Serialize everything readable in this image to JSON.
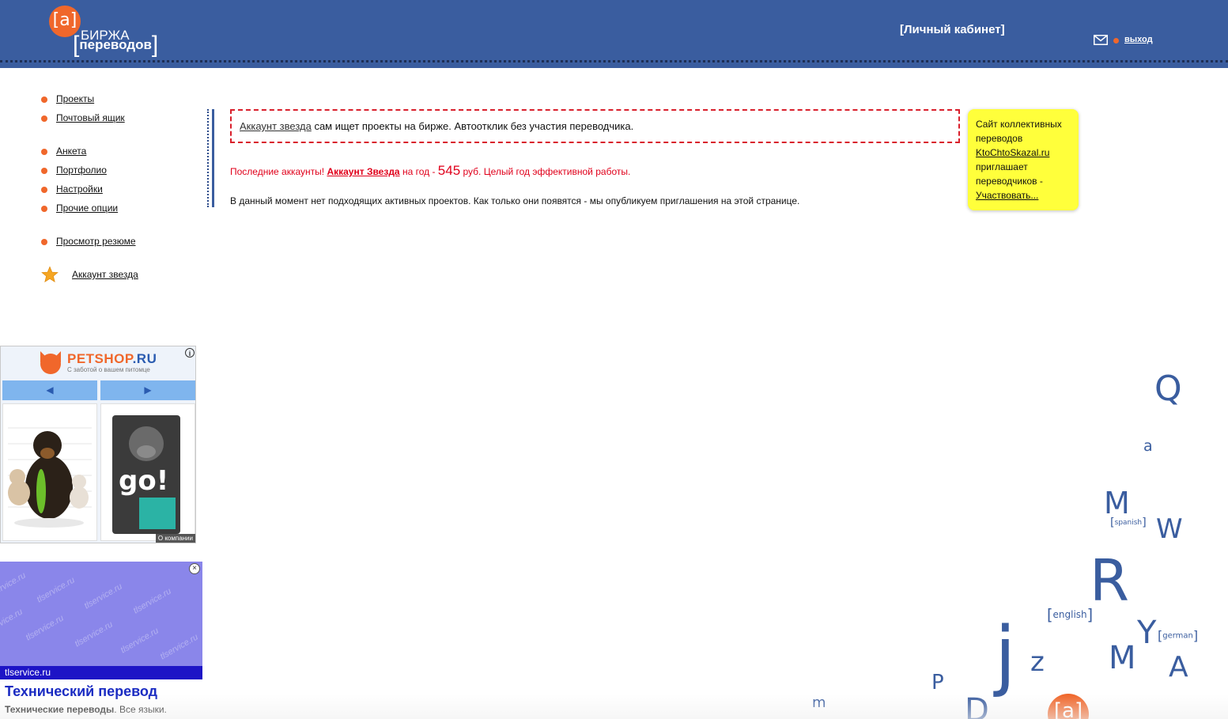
{
  "header": {
    "logo_badge": "[a]",
    "logo_top": "БИРЖА",
    "logo_bottom": "переводов",
    "cabinet_title": "[Личный кабинет]",
    "logout": "выход",
    "colors": {
      "bar": "#3a5d9f",
      "accent": "#f0672b"
    }
  },
  "sidebar": {
    "items": [
      {
        "label": "Проекты"
      },
      {
        "label": "Почтовый ящик"
      },
      {
        "label": "Анкета"
      },
      {
        "label": "Портфолио"
      },
      {
        "label": "Настройки"
      },
      {
        "label": "Прочие опции"
      },
      {
        "label": "Просмотр резюме"
      },
      {
        "label": "Аккаунт звезда"
      }
    ]
  },
  "notice": {
    "link": "Аккаунт звезда",
    "text": " сам ищет проекты на бирже. Автоотклик без участия переводчика."
  },
  "promo": {
    "prefix": "Последние аккаунты! ",
    "link": "Аккаунт Звезда",
    "middle": " на год - ",
    "price": "545",
    "suffix": " руб. Целый год эффективной работы."
  },
  "status_text": "В данный момент нет подходящих активных проектов. Как только они появятся - мы опубликуем приглашения на этой странице.",
  "yellow_note": {
    "line1": "Сайт коллективных переводов",
    "link": "KtoChtoSkazal.ru",
    "line2": "приглашает переводчиков -",
    "cta": "Участвовать..."
  },
  "petshop_ad": {
    "brand": "PETSHOP",
    "brand_tld": ".RU",
    "tagline": "С заботой о вашем питомце",
    "prev_arrow": "◀",
    "next_arrow": "▶",
    "product_text": "go!",
    "about": "О компании"
  },
  "tl_ad": {
    "watermark": "tlservice.ru",
    "domain": "tlservice.ru",
    "title": "Технический перевод",
    "desc_bold": "Технические переводы",
    "desc_rest": ". Все языки."
  },
  "decor": {
    "letters": [
      "Q",
      "a",
      "M",
      "W",
      "R",
      "j",
      "z",
      "Y",
      "M",
      "A",
      "P",
      "m",
      "D"
    ],
    "lang_tags": [
      "spanish",
      "english",
      "german"
    ],
    "bottom_badge": "[a]"
  }
}
